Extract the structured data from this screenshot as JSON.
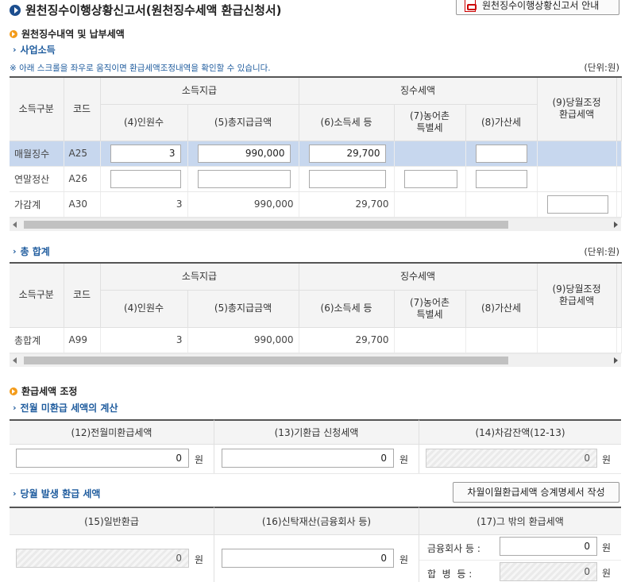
{
  "header": {
    "title": "원천징수이행상황신고서(원천징수세액 환급신청서)",
    "guide_button": "원천징수이행상황신고서 안내"
  },
  "section1": {
    "title": "원천징수내역 및 납부세액",
    "sub_title": "사업소득",
    "scroll_note": "※ 아래 스크롤을 좌우로 움직이면 환급세액조정내역을 확인할 수 있습니다.",
    "unit": "(단위:원)"
  },
  "table_headers": {
    "income_type": "소득구분",
    "code": "코드",
    "income_payment": "소득지급",
    "withholding_tax": "징수세액",
    "col4": "(4)인원수",
    "col5": "(5)총지급금액",
    "col6": "(6)소득세 등",
    "col7_line1": "(7)농어촌",
    "col7_line2": "특별세",
    "col8": "(8)가산세",
    "col9_line1": "(9)당월조정",
    "col9_line2": "환급세액"
  },
  "table1_rows": [
    {
      "type": "매월징수",
      "code": "A25",
      "people": "3",
      "total": "990,000",
      "tax": "29,700"
    },
    {
      "type": "연말정산",
      "code": "A26",
      "people": "",
      "total": "",
      "tax": ""
    },
    {
      "type": "가감계",
      "code": "A30",
      "people": "3",
      "total": "990,000",
      "tax": "29,700"
    }
  ],
  "section_total": {
    "title": "총 합계",
    "unit": "(단위:원)"
  },
  "table2_rows": [
    {
      "type": "총합계",
      "code": "A99",
      "people": "3",
      "total": "990,000",
      "tax": "29,700"
    }
  ],
  "refund": {
    "title": "환급세액 조정",
    "prev_title": "전월 미환급 세액의 계산",
    "h12": "(12)전월미환급세액",
    "h13": "(13)기환급 신청세액",
    "h14": "(14)차감잔액(12-13)",
    "v12": "0",
    "v13": "0",
    "v14": "0",
    "won": "원",
    "curr_title": "당월 발생 환급 세액",
    "carry_button": "차월이월환급세액 승계명세서 작성",
    "h15": "(15)일반환급",
    "h16": "(16)신탁재산(금융회사 등)",
    "h17": "(17)그 밖의 환급세액",
    "v15": "0",
    "v16": "0",
    "fin_label": "금융회사 등 :",
    "fin_value": "0",
    "merge_label": "합  병  등 :",
    "merge_value": "0"
  }
}
